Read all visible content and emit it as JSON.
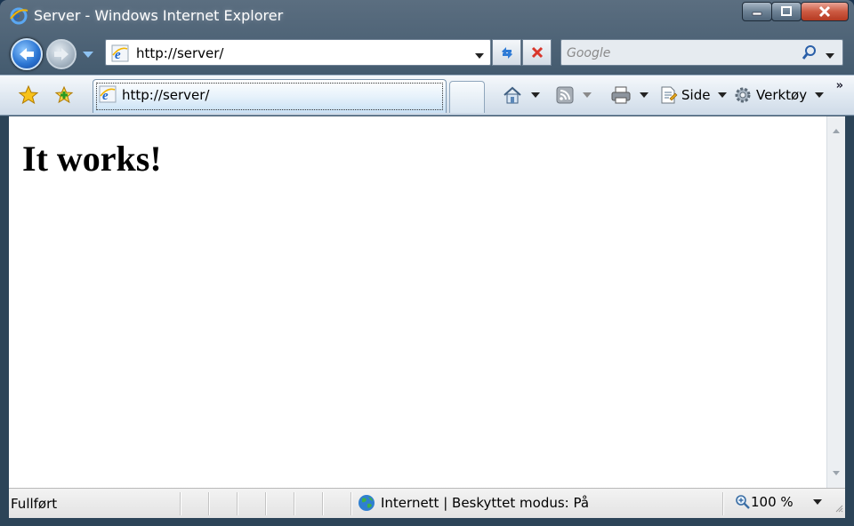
{
  "window": {
    "title": "Server - Windows Internet Explorer"
  },
  "navigation": {
    "address_url": "http://server/",
    "search_placeholder": "Google"
  },
  "command_bar": {
    "tab_label": "http://server/",
    "page_menu_label": "Side",
    "tools_menu_label": "Verktøy",
    "overflow_label": "»"
  },
  "page": {
    "heading": "It works!"
  },
  "status_bar": {
    "status_text": "Fullført",
    "zone_text": "Internett | Beskyttet modus: På",
    "zoom_text": "100 %"
  },
  "icons": {
    "app": "ie-logo-icon",
    "back": "back-arrow-icon",
    "forward": "forward-arrow-icon",
    "refresh": "refresh-icon",
    "stop": "stop-icon",
    "search": "search-icon",
    "favorites": "favorites-star-icon",
    "add_favorite": "add-favorite-icon",
    "home": "home-icon",
    "feeds": "rss-feed-icon",
    "print": "print-icon",
    "page": "page-icon",
    "tools": "gear-icon",
    "zone": "globe-icon",
    "zoom": "zoom-icon"
  },
  "colors": {
    "frame": "#2c4458",
    "close_button": "#cc5a42",
    "back_button": "#2d77d4"
  }
}
